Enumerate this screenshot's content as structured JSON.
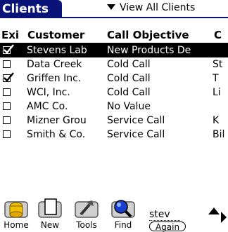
{
  "app": {
    "title": "Clients",
    "view_picker": "View All Clients"
  },
  "table": {
    "columns": [
      "Exi",
      "Customer",
      "Call Objective",
      "C"
    ],
    "rows": [
      {
        "checked": true,
        "customer": "Stevens Lab",
        "objective": "New Products De",
        "c": "",
        "selected": true
      },
      {
        "checked": false,
        "customer": "Data Creek",
        "objective": "Cold Call",
        "c": "St",
        "selected": false
      },
      {
        "checked": true,
        "customer": "Griffen Inc.",
        "objective": "Cold Call",
        "c": "T",
        "selected": false
      },
      {
        "checked": false,
        "customer": "WCI, Inc.",
        "objective": "Cold Call",
        "c": "Li",
        "selected": false
      },
      {
        "checked": false,
        "customer": "AMC Co.",
        "objective": "No Value",
        "c": "",
        "selected": false
      },
      {
        "checked": false,
        "customer": "Mizner Grou",
        "objective": "Service Call",
        "c": "K",
        "selected": false
      },
      {
        "checked": false,
        "customer": "Smith & Co.",
        "objective": "Service Call",
        "c": "Bil",
        "selected": false
      }
    ]
  },
  "toolbar": {
    "home_label": "Home",
    "new_label": "New",
    "tools_label": "Tools",
    "find_label": "Find",
    "find_text": "stev",
    "again_label": "Again"
  },
  "colors": {
    "title_bg": "#0a1478",
    "selected_row_bg": "#000000"
  },
  "icons": [
    "dropdown-arrow-icon",
    "home-icon",
    "new-document-icon",
    "tools-icon",
    "magnifier-icon",
    "scroll-arrows-icon"
  ]
}
